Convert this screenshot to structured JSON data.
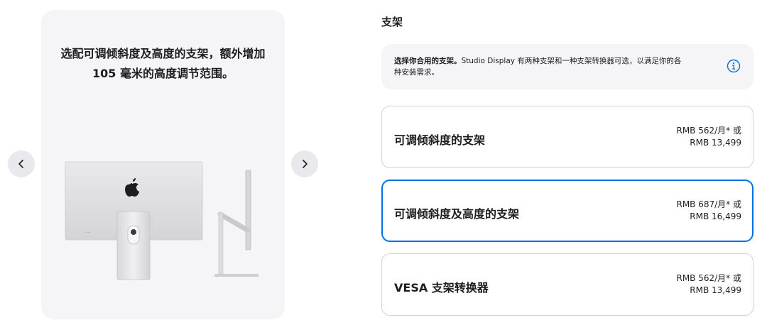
{
  "gallery": {
    "caption_line1": "选配可调倾斜度及高度的支架，额外增加",
    "caption_line2": "105 毫米的高度调节范围。",
    "prev_icon": "chevron-left-icon",
    "next_icon": "chevron-right-icon"
  },
  "section": {
    "title": "支架"
  },
  "info": {
    "bold": "选择你合用的支架。",
    "line1_rest": "Studio Display 有两种支架和一种支架转换器可选，以满足你的各",
    "line2": "种安装需求。",
    "icon": "info-icon"
  },
  "options": [
    {
      "title": "可调倾斜度的支架",
      "price_monthly": "RMB 562/月* 或",
      "price_full": "RMB 13,499",
      "selected": false
    },
    {
      "title": "可调倾斜度及高度的支架",
      "price_monthly": "RMB 687/月* 或",
      "price_full": "RMB 16,499",
      "selected": true
    },
    {
      "title": "VESA 支架转换器",
      "price_monthly": "RMB 562/月* 或",
      "price_full": "RMB 13,499",
      "selected": false
    }
  ],
  "colors": {
    "accent": "#0071e3",
    "card_bg": "#f5f5f7",
    "border": "#d2d2d7"
  }
}
